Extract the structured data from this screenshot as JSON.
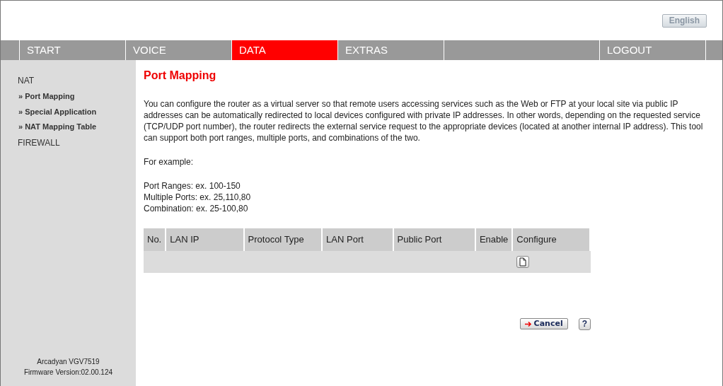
{
  "language_button": "English",
  "nav": [
    {
      "label": "START",
      "selected": false
    },
    {
      "label": "VOICE",
      "selected": false
    },
    {
      "label": "DATA",
      "selected": true
    },
    {
      "label": "EXTRAS",
      "selected": false
    },
    {
      "label": "LOGOUT",
      "selected": false
    }
  ],
  "sidebar": {
    "groups": [
      {
        "label": "NAT",
        "children": [
          {
            "label": "» Port Mapping"
          },
          {
            "label": "» Special Application"
          },
          {
            "label": "» NAT Mapping Table"
          }
        ]
      },
      {
        "label": "FIREWALL"
      }
    ],
    "footer": [
      "Arcadyan VGV7519",
      "Firmware Version:02.00.124"
    ]
  },
  "page_title": "Port Mapping",
  "intro": "You can configure the router as a virtual server so that remote users accessing services such as the Web or FTP at your local site via public IP addresses can be automatically redirected to local devices configured with private IP addresses. In other words, depending on the requested service (TCP/UDP port number), the router redirects the external service request to the appropriate devices (located at another internal IP address). This tool can support both port ranges, multiple ports, and combinations of the two.",
  "example_heading": "For example:",
  "examples": [
    "Port Ranges: ex. 100-150",
    "Multiple Ports: ex. 25,110,80",
    "Combination: ex. 25-100,80"
  ],
  "table": {
    "columns": [
      "No.",
      "LAN IP",
      "Protocol Type",
      "LAN Port",
      "Public Port",
      "Enable",
      "Configure"
    ]
  },
  "buttons": {
    "cancel": "Cancel",
    "help": "?"
  }
}
